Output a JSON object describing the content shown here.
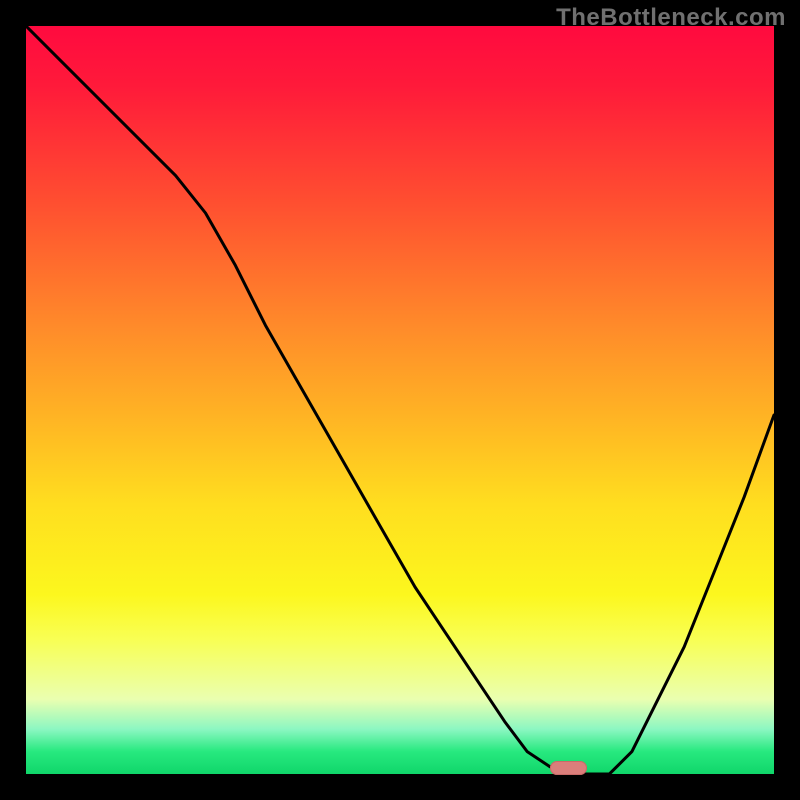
{
  "watermark": "TheBottleneck.com",
  "colors": {
    "curve": "#000000",
    "marker_fill": "#db7e7b",
    "marker_stroke": "#c96a67",
    "frame": "#000000"
  },
  "chart_data": {
    "type": "line",
    "title": "",
    "xlabel": "",
    "ylabel": "",
    "xlim": [
      0,
      100
    ],
    "ylim": [
      0,
      100
    ],
    "series": [
      {
        "name": "curve",
        "x": [
          0,
          4,
          8,
          12,
          16,
          20,
          24,
          28,
          32,
          36,
          40,
          44,
          48,
          52,
          56,
          60,
          64,
          67,
          70,
          72,
          74,
          76,
          78,
          81,
          84,
          88,
          92,
          96,
          100
        ],
        "y": [
          100,
          96,
          92,
          88,
          84,
          80,
          75,
          68,
          60,
          53,
          46,
          39,
          32,
          25,
          19,
          13,
          7,
          3,
          1,
          0,
          0,
          0,
          0,
          3,
          9,
          17,
          27,
          37,
          48
        ]
      }
    ],
    "marker": {
      "x": 72.5,
      "y": 0.8,
      "width_pct": 5,
      "height_pct": 2
    }
  }
}
